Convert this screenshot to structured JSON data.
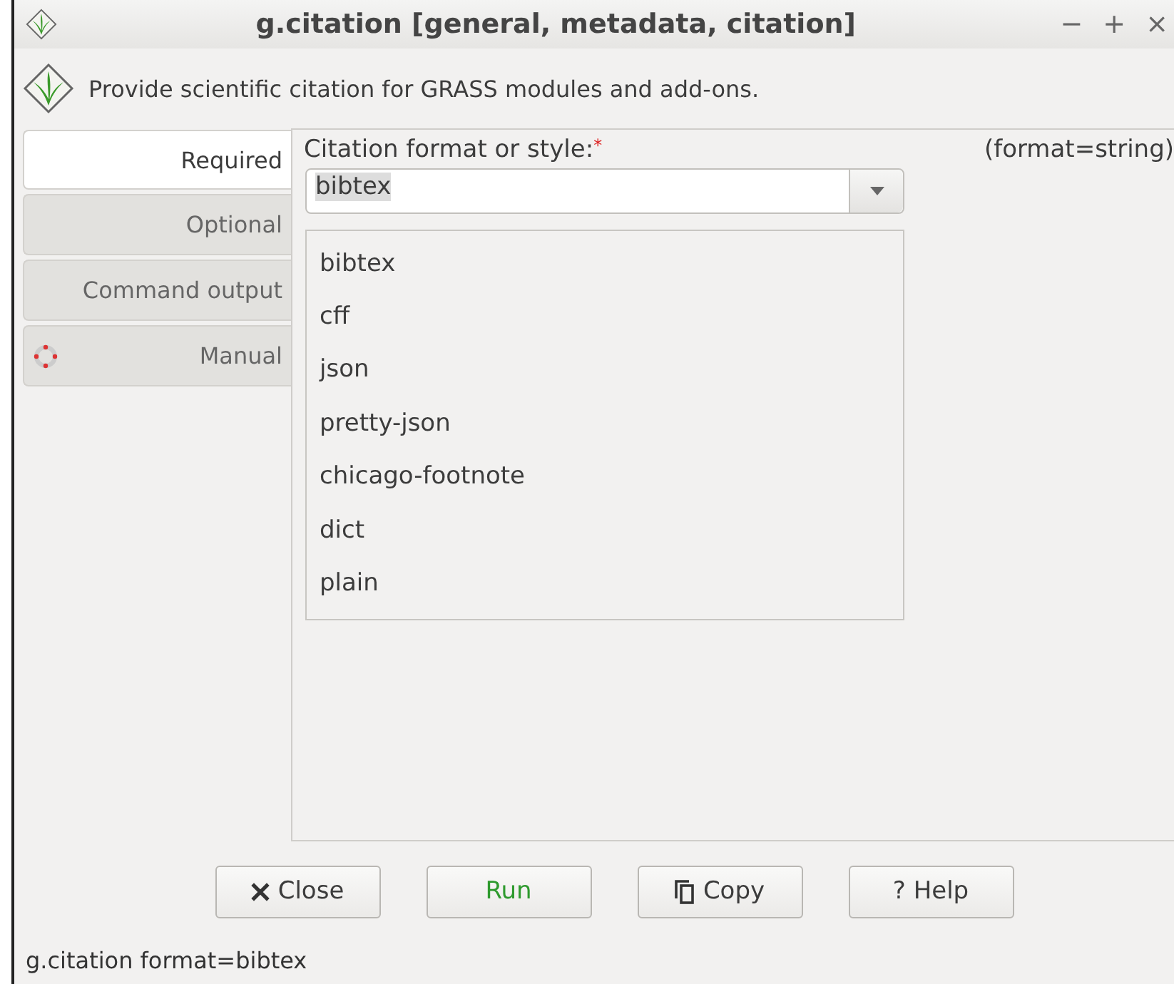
{
  "window": {
    "title": "g.citation [general, metadata, citation]",
    "controls": [
      "−",
      "+",
      "×"
    ]
  },
  "description": "Provide scientific citation for GRASS modules and add-ons.",
  "tabs": [
    {
      "label": "Required",
      "selected": true,
      "kind": "plain"
    },
    {
      "label": "Optional",
      "selected": false,
      "kind": "plain"
    },
    {
      "label": "Command output",
      "selected": false,
      "kind": "plain"
    },
    {
      "label": "Manual",
      "selected": false,
      "kind": "help"
    }
  ],
  "parameter": {
    "label": "Citation format or style:",
    "required_mark": "*",
    "type_hint": "(format=string)",
    "value": "bibtex",
    "expanded": true,
    "options": [
      "bibtex",
      "cff",
      "json",
      "pretty-json",
      "chicago-footnote",
      "dict",
      "plain"
    ]
  },
  "buttons": [
    {
      "label": "Close",
      "kind": "close"
    },
    {
      "label": "Run",
      "kind": "run"
    },
    {
      "label": "Copy",
      "kind": "copy"
    },
    {
      "label": "? Help",
      "kind": "help"
    }
  ],
  "status_bar": "g.citation format=bibtex"
}
